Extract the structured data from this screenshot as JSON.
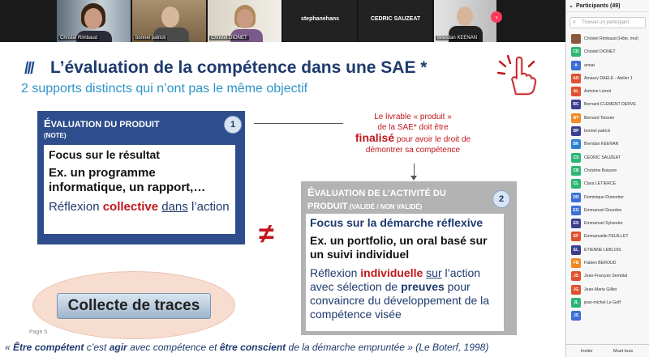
{
  "videos": [
    {
      "caption": "Christel Rimbaud"
    },
    {
      "caption": "bonnel patrick"
    },
    {
      "caption": "Christel DIONET"
    },
    {
      "name": "stephanehans"
    },
    {
      "name": "CEDRIC SAUZEAT"
    },
    {
      "caption": "Brendan KEENAN"
    }
  ],
  "slide": {
    "marks": "///",
    "title": "L’évaluation de la compétence dans une SAE *",
    "subtitle": "2 supports distincts qui n’ont pas le même objectif",
    "box1": {
      "head_first": "É",
      "head_rest": "VALUATION DU PRODUIT",
      "note": "(NOTE)",
      "badge": "1",
      "line1": "Focus sur le résultat",
      "line2": "Ex. un programme informatique, un rapport,…",
      "line3_a": "Réflexion ",
      "line3_b": "collective",
      "line3_c": " ",
      "line3_d": "dans",
      "line3_e": " l’action"
    },
    "note_right": {
      "a": "Le livrable « produit »",
      "b": "de la SAE* doit être",
      "c": "finalisé",
      "d": " pour avoir le droit de",
      "e": "démontrer sa compétence"
    },
    "neq": "≠",
    "box2": {
      "head_first": "É",
      "head_rest": "VALUATION DE L’ACTIVITÉ DU PRODUIT",
      "head_small": " (VALIDÉ / NON VALIDÉ)",
      "badge": "2",
      "line1": "Focus sur la démarche réflexive",
      "line2": "Ex. un portfolio, un oral basé sur un suivi individuel",
      "line3_a": "Réflexion ",
      "line3_b": "individuelle",
      "line3_c": " ",
      "line3_d": "sur",
      "line3_e": " l’action avec sélection de ",
      "line3_f": "preuves",
      "line3_g": " pour convaincre du développement de la compétence visée"
    },
    "collecte": "Collecte de traces",
    "page_label": "Page 5",
    "quote": {
      "a": "« ",
      "b": "Être compétent",
      "c": " c’est ",
      "d": "agir",
      "e": " avec compétence et ",
      "f": "être conscient",
      "g": " de la démarche emprunté",
      "h": "e » (Le Boterf, 1998)"
    }
  },
  "participants": {
    "header": "Participants (49)",
    "search_placeholder": "Trouver un participant",
    "list": [
      {
        "initials": "",
        "name": "Christel Rimbaud (Hôte, moi)",
        "color": "#8b5a3c"
      },
      {
        "initials": "CD",
        "name": "Christel DIONET",
        "color": "#2bb673"
      },
      {
        "initials": "A",
        "name": "annat",
        "color": "#3d6fd6"
      },
      {
        "initials": "AD",
        "name": "Amaury DAELE - Atelier 1",
        "color": "#e0502e"
      },
      {
        "initials": "AL",
        "name": "Antoine Lemot",
        "color": "#e0502e"
      },
      {
        "initials": "BC",
        "name": "Bernard CLEMENT DERVE",
        "color": "#3a3f8f"
      },
      {
        "initials": "BT",
        "name": "Bernard Toissier",
        "color": "#f08a24"
      },
      {
        "initials": "BP",
        "name": "bonnel patrick",
        "color": "#3a3f8f"
      },
      {
        "initials": "BK",
        "name": "Brendan KEENAN",
        "color": "#2a7fd4"
      },
      {
        "initials": "CS",
        "name": "CEDRIC SAUZEAT",
        "color": "#2bb673"
      },
      {
        "initials": "CB",
        "name": "Christine Buisson",
        "color": "#2bb673"
      },
      {
        "initials": "CL",
        "name": "Clara LETIERCE",
        "color": "#2bb673"
      },
      {
        "initials": "DD",
        "name": "Dominique Dumortier",
        "color": "#3d6fd6"
      },
      {
        "initials": "EG",
        "name": "Emmanuel Gourdon",
        "color": "#3d6fd6"
      },
      {
        "initials": "ES",
        "name": "Emmanuel Sylvestre",
        "color": "#3a3f8f"
      },
      {
        "initials": "EF",
        "name": "Emmanuelle FEUILLET",
        "color": "#e0502e"
      },
      {
        "initials": "EL",
        "name": "ETIENNE LEBLOIS",
        "color": "#3a3f8f"
      },
      {
        "initials": "FB",
        "name": "Fabien BEROUD",
        "color": "#f08a24"
      },
      {
        "initials": "JS",
        "name": "Jean-François Semblat",
        "color": "#e0502e"
      },
      {
        "initials": "JG",
        "name": "Jean-Marie Gilliot",
        "color": "#e0502e"
      },
      {
        "initials": "JL",
        "name": "jean-michel Le Goff",
        "color": "#2bb673"
      },
      {
        "initials": "JS",
        "name": "",
        "color": "#3d6fd6"
      }
    ],
    "invite_label": "Inviter",
    "mute_label": "Muet tous"
  },
  "colors": {
    "title_blue": "#1f3a6e",
    "subtitle_blue": "#2e94c8",
    "box1_blue": "#2e4d8c",
    "box2_grey": "#b3b3b3",
    "accent_red": "#c0171c",
    "nav_arrow": "#ff3b5c"
  }
}
